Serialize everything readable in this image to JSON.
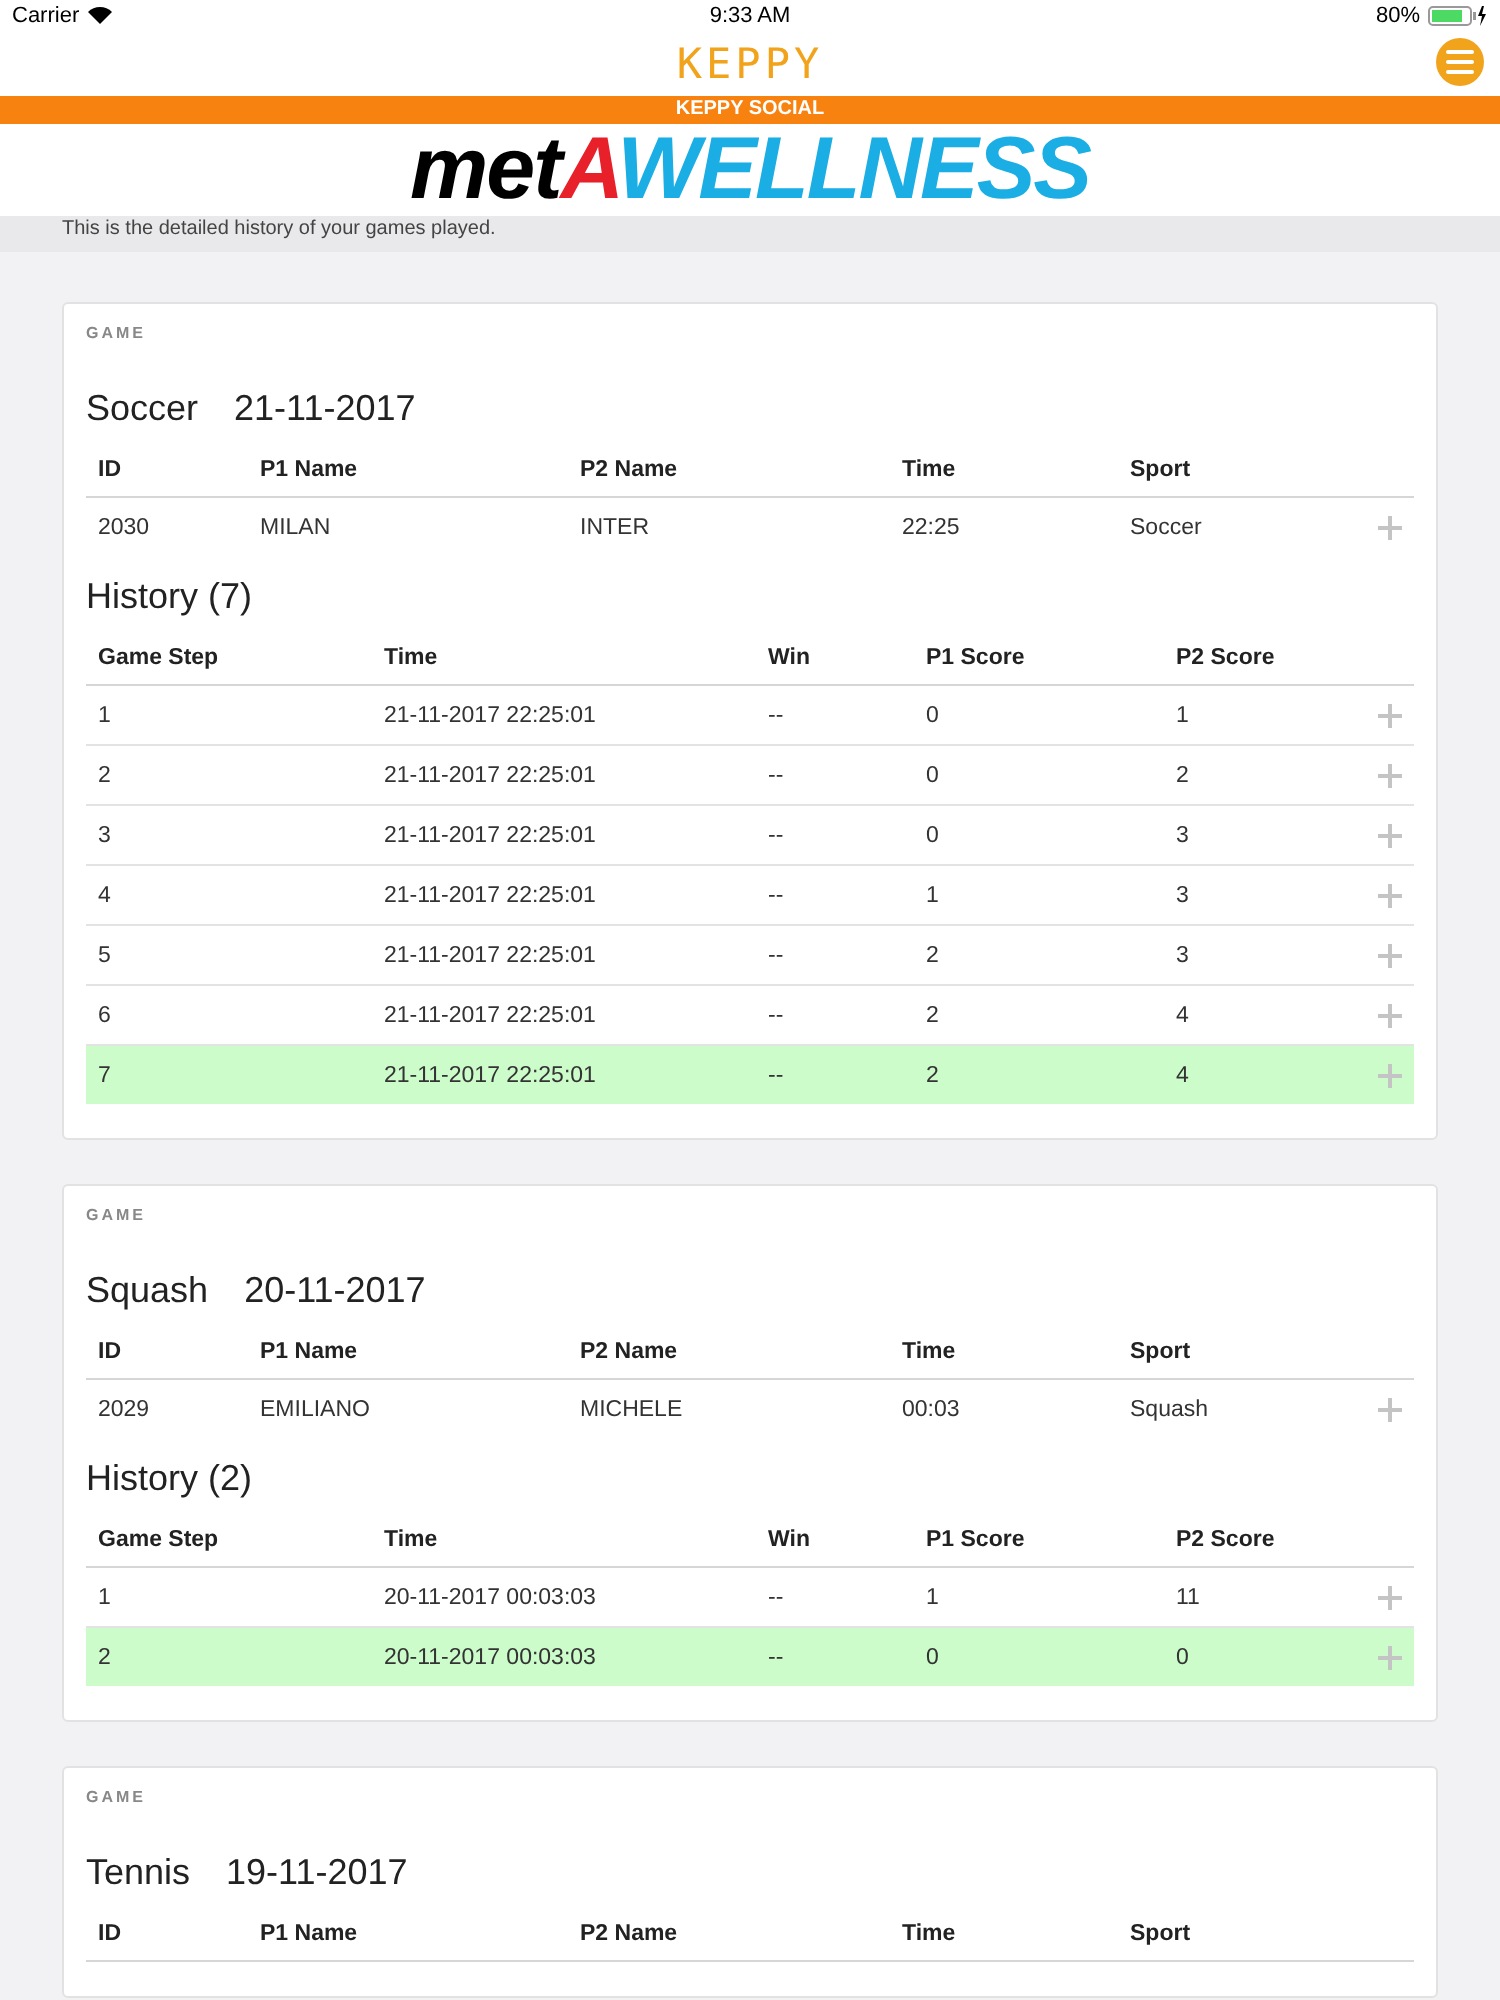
{
  "status_bar": {
    "carrier": "Carrier",
    "time": "9:33 AM",
    "battery": "80%"
  },
  "header": {
    "logo": "KEPPY",
    "banner": "KEPPY SOCIAL"
  },
  "brand": {
    "parts": [
      {
        "text": "met",
        "color": "#000000"
      },
      {
        "text": "A",
        "color": "#e8202a"
      },
      {
        "text": "WELLNESS",
        "color": "#1aaee5"
      }
    ]
  },
  "intro": "This is the detailed history of your games played.",
  "games": [
    {
      "label": "GAME",
      "sport": "Soccer",
      "date": "21-11-2017",
      "columns": [
        "ID",
        "P1 Name",
        "P2 Name",
        "Time",
        "Sport"
      ],
      "rows": [
        [
          "2030",
          "MILAN",
          "INTER",
          "22:25",
          "Soccer"
        ]
      ],
      "history": {
        "title": "History (7)",
        "columns": [
          "Game Step",
          "Time",
          "Win",
          "P1 Score",
          "P2 Score"
        ],
        "rows": [
          {
            "cells": [
              "1",
              "21-11-2017 22:25:01",
              "--",
              "0",
              "1"
            ],
            "highlighted": false
          },
          {
            "cells": [
              "2",
              "21-11-2017 22:25:01",
              "--",
              "0",
              "2"
            ],
            "highlighted": false
          },
          {
            "cells": [
              "3",
              "21-11-2017 22:25:01",
              "--",
              "0",
              "3"
            ],
            "highlighted": false
          },
          {
            "cells": [
              "4",
              "21-11-2017 22:25:01",
              "--",
              "1",
              "3"
            ],
            "highlighted": false
          },
          {
            "cells": [
              "5",
              "21-11-2017 22:25:01",
              "--",
              "2",
              "3"
            ],
            "highlighted": false
          },
          {
            "cells": [
              "6",
              "21-11-2017 22:25:01",
              "--",
              "2",
              "4"
            ],
            "highlighted": false
          },
          {
            "cells": [
              "7",
              "21-11-2017 22:25:01",
              "--",
              "2",
              "4"
            ],
            "highlighted": true
          }
        ]
      }
    },
    {
      "label": "GAME",
      "sport": "Squash",
      "date": "20-11-2017",
      "columns": [
        "ID",
        "P1 Name",
        "P2 Name",
        "Time",
        "Sport"
      ],
      "rows": [
        [
          "2029",
          "EMILIANO",
          "MICHELE",
          "00:03",
          "Squash"
        ]
      ],
      "history": {
        "title": "History (2)",
        "columns": [
          "Game Step",
          "Time",
          "Win",
          "P1 Score",
          "P2 Score"
        ],
        "rows": [
          {
            "cells": [
              "1",
              "20-11-2017 00:03:03",
              "--",
              "1",
              "11"
            ],
            "highlighted": false
          },
          {
            "cells": [
              "2",
              "20-11-2017 00:03:03",
              "--",
              "0",
              "0"
            ],
            "highlighted": true
          }
        ]
      }
    },
    {
      "label": "GAME",
      "sport": "Tennis",
      "date": "19-11-2017",
      "columns": [
        "ID",
        "P1 Name",
        "P2 Name",
        "Time",
        "Sport"
      ]
    }
  ]
}
